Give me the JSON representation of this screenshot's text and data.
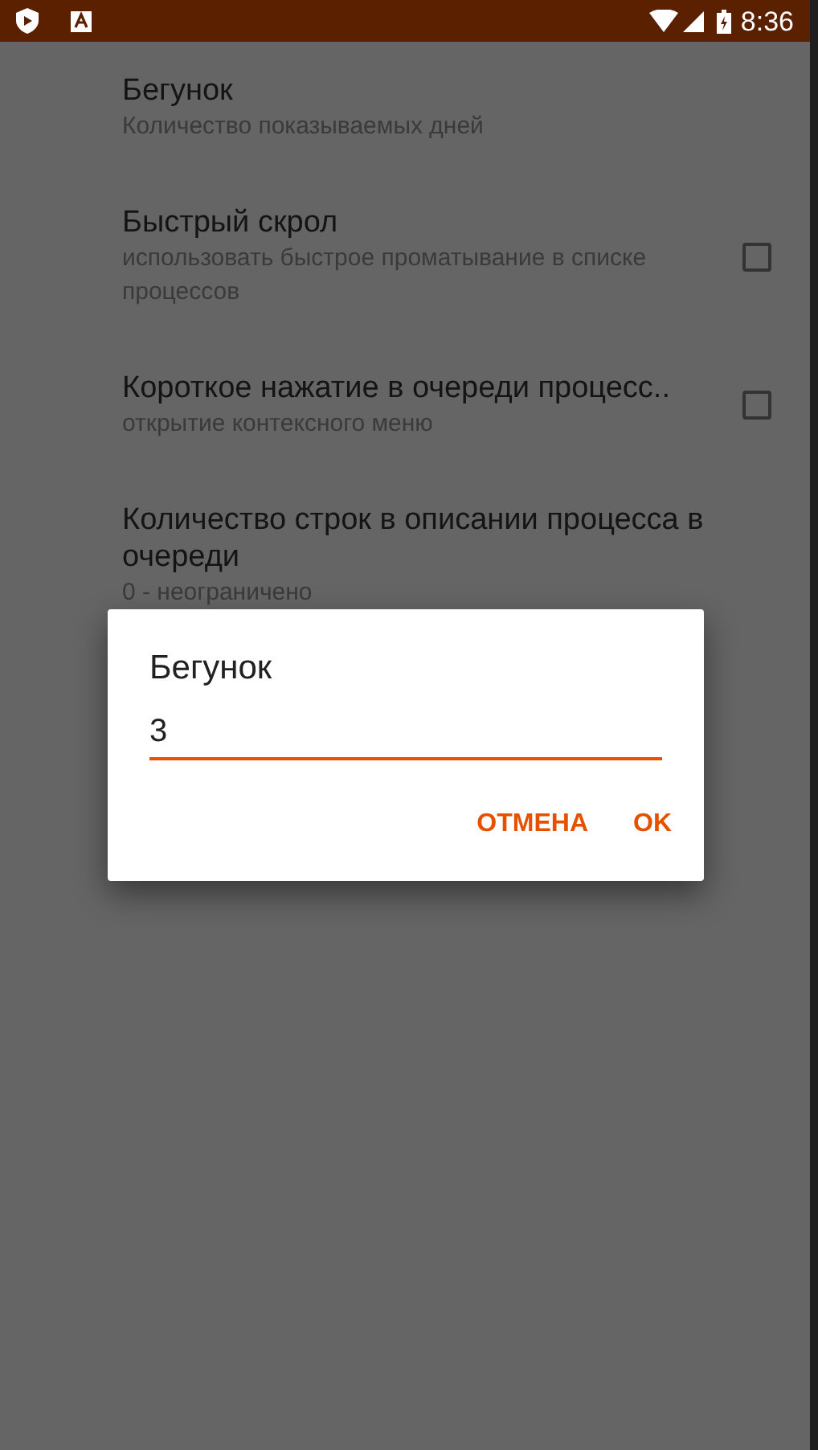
{
  "status_bar": {
    "time": "8:36"
  },
  "settings": [
    {
      "kind": "text",
      "title": "Бегунок",
      "subtitle": "Количество показываемых дней"
    },
    {
      "kind": "checkbox",
      "title": "Быстрый скрол",
      "subtitle": "использовать быстрое проматывание в списке процессов",
      "checked": false
    },
    {
      "kind": "checkbox",
      "title": "Короткое нажатие в очереди процесс..",
      "subtitle": "открытие контексного меню",
      "checked": false
    },
    {
      "kind": "text",
      "title": "Количество строк в описании процесса в очереди",
      "subtitle": "0 - неограничено"
    }
  ],
  "dialog": {
    "title": "Бегунок",
    "value": "3",
    "buttons": [
      "ОТМЕНА",
      "OK"
    ]
  }
}
